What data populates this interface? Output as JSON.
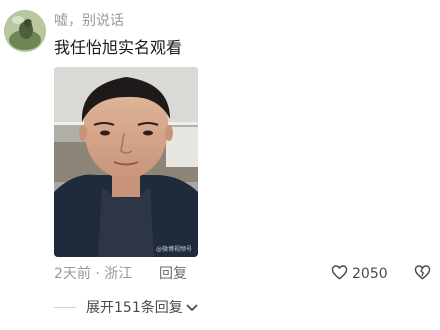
{
  "comment": {
    "username": "嘘，别说话",
    "text": "我任怡旭实名观看",
    "image_watermark": "@微博视频号",
    "time": "2天前",
    "location": "浙江",
    "reply_label": "回复",
    "likes": "2050"
  },
  "replies": {
    "expand_label": "展开151条回复"
  },
  "icons": {
    "like": "heart-outline-icon",
    "dislike": "broken-heart-icon",
    "expand": "chevron-down-icon"
  }
}
